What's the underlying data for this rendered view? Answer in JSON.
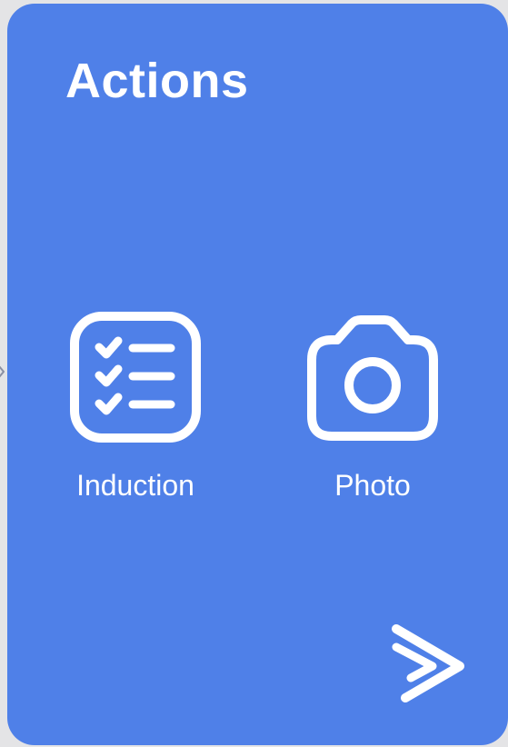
{
  "card": {
    "title": "Actions",
    "background_color": "#4f80e8",
    "text_color": "#ffffff"
  },
  "actions": [
    {
      "label": "Induction",
      "icon": "checklist-icon"
    },
    {
      "label": "Photo",
      "icon": "camera-icon"
    }
  ],
  "logo": {
    "icon": "play-logo-icon"
  },
  "edge_indicator": {
    "icon": "chevron-right-icon"
  }
}
